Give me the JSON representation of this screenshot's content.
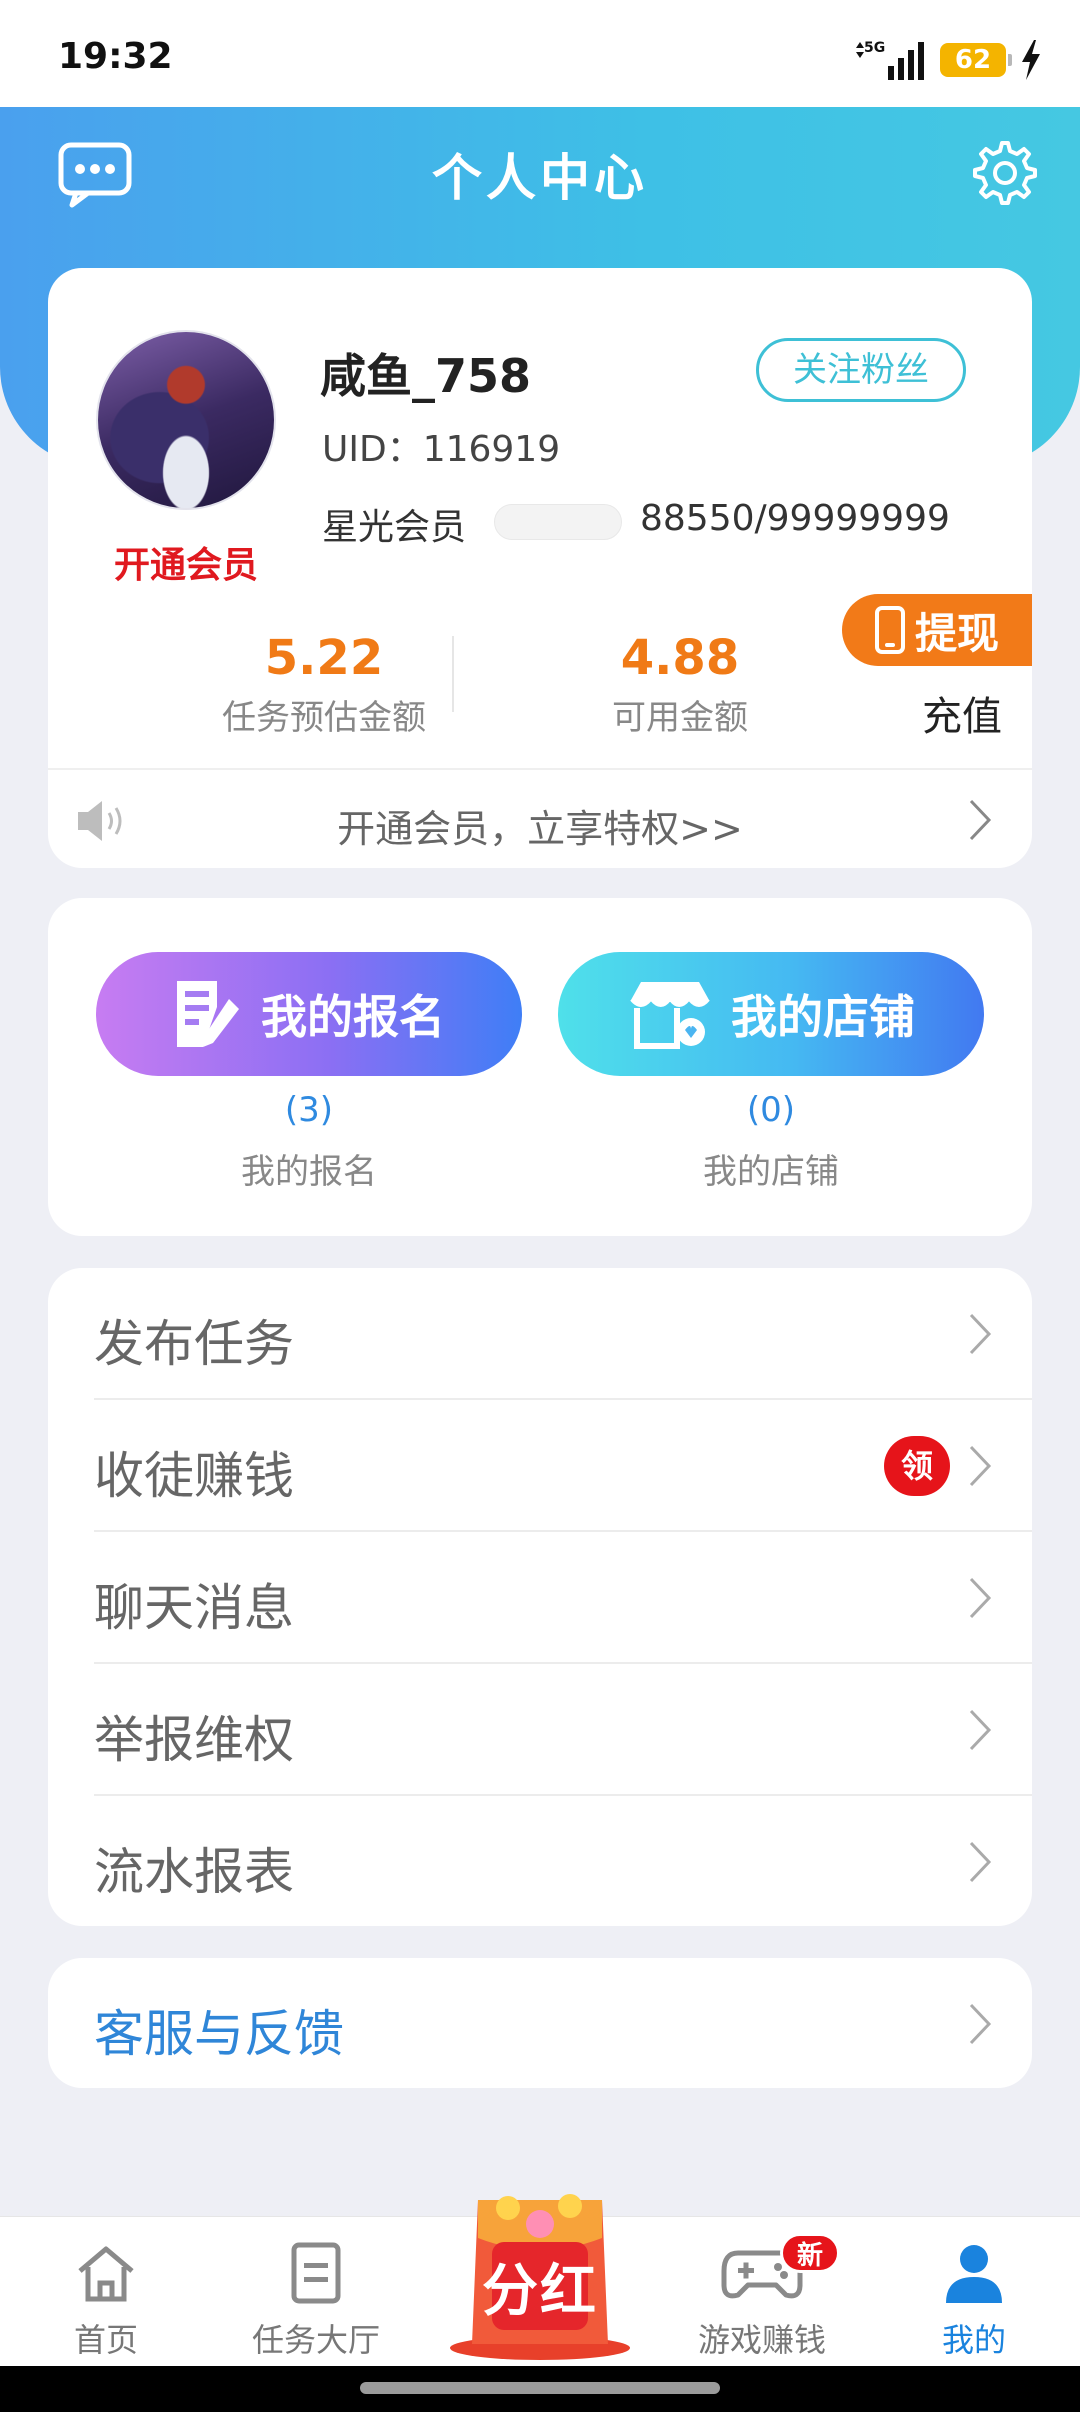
{
  "status_bar": {
    "time": "19:32",
    "network": "5G",
    "battery": "62"
  },
  "header": {
    "title": "个人中心",
    "left_icon": "message-icon",
    "right_icon": "gear-icon"
  },
  "profile": {
    "username": "咸鱼_758",
    "uid": "UID：116919",
    "follow_label": "关注粉丝",
    "open_vip_label": "开通会员",
    "member_label": "星光会员",
    "member_progress": "88550/99999999",
    "task_amount": "5.22",
    "task_amount_label": "任务预估金额",
    "available_amount": "4.88",
    "available_amount_label": "可用金额",
    "withdraw_label": "提现",
    "recharge_label": "充值",
    "notice": "开通会员，立享特权>>"
  },
  "actions": {
    "signup_button": "我的报名",
    "signup_count": "(3)",
    "signup_label": "我的报名",
    "store_button": "我的店铺",
    "store_count": "(0)",
    "store_label": "我的店铺"
  },
  "menu": {
    "items": [
      {
        "label": "发布任务"
      },
      {
        "label": "收徒赚钱",
        "badge": "领"
      },
      {
        "label": "聊天消息"
      },
      {
        "label": "举报维权"
      },
      {
        "label": "流水报表"
      }
    ],
    "service": "客服与反馈"
  },
  "bottom_nav": {
    "items": [
      {
        "label": "首页",
        "icon": "home-icon"
      },
      {
        "label": "任务大厅",
        "icon": "task-list-icon"
      },
      {
        "label": "游戏赚钱",
        "icon": "gamepad-icon",
        "badge": "新"
      },
      {
        "label": "我的",
        "icon": "user-icon"
      }
    ],
    "center_button": "分红",
    "active": "我的"
  },
  "colors": {
    "header_blue": "#4aa0ee",
    "accent_orange": "#f07a16",
    "active_blue": "#1a83de",
    "badge_red": "#e6141a"
  }
}
